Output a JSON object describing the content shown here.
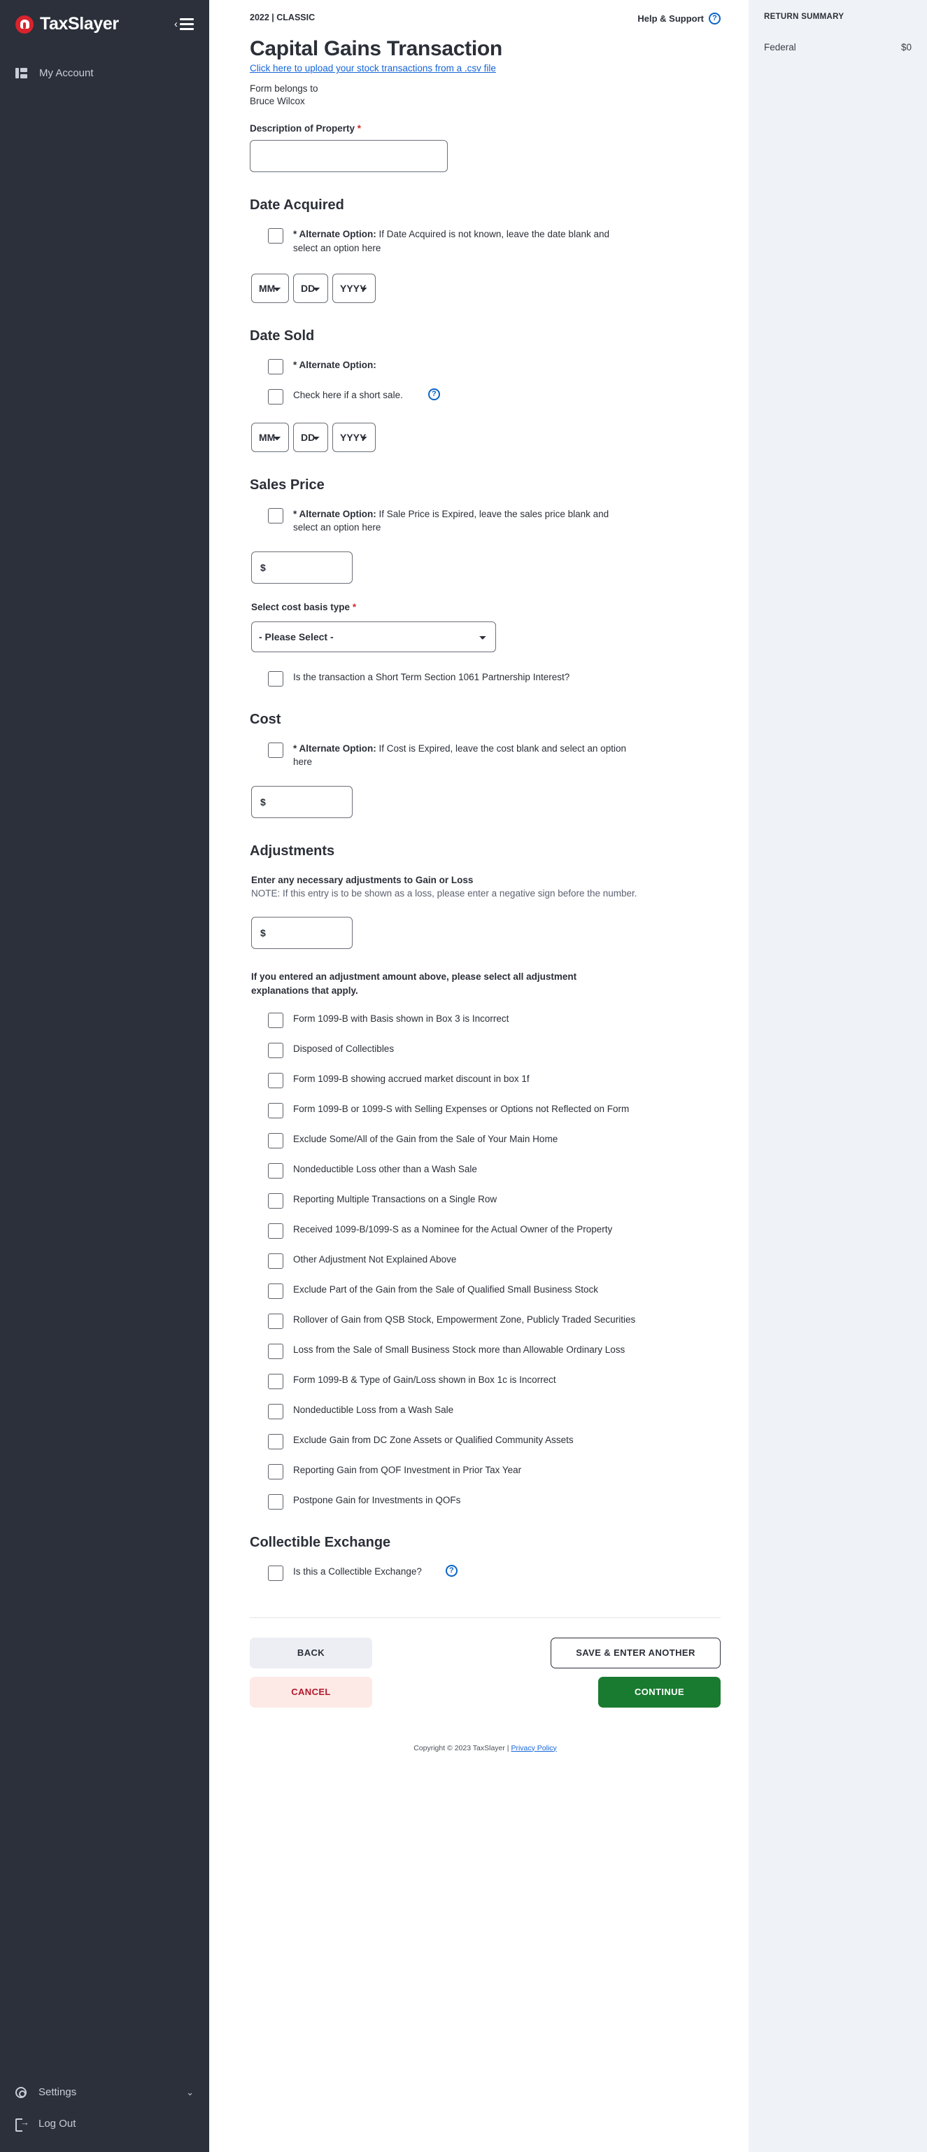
{
  "sidebar": {
    "brand": "TaxSlayer",
    "collapse_label": "‹",
    "items": [
      {
        "label": "My Account"
      }
    ],
    "bottom_items": [
      {
        "label": "Settings",
        "caret": "⌄"
      },
      {
        "label": "Log Out"
      }
    ]
  },
  "topbar": {
    "tax_year_package": "2022 | CLASSIC",
    "help_label": "Help & Support",
    "help_icon_glyph": "?"
  },
  "summary": {
    "title": "RETURN SUMMARY",
    "rows": [
      {
        "label": "Federal",
        "value": "$0"
      }
    ]
  },
  "page": {
    "title": "Capital Gains Transaction",
    "csv_link": "Click here to upload your stock transactions from a .csv file",
    "belongs_label": "Form belongs to",
    "belongs_name": "Bruce Wilcox"
  },
  "description": {
    "label": "Description of Property",
    "required_mark": "*",
    "value": "",
    "placeholder": ""
  },
  "date_acquired": {
    "heading": "Date Acquired",
    "alt_prefix": "* Alternate Option:",
    "alt_text": " If Date Acquired is not known, leave the date blank and select an option here",
    "mm": "MM",
    "dd": "DD",
    "yyyy": "YYYY"
  },
  "date_sold": {
    "heading": "Date Sold",
    "alt_prefix": "* Alternate Option:",
    "alt_text": "",
    "short_sale_label": "Check here if a short sale.",
    "help_glyph": "?",
    "mm": "MM",
    "dd": "DD",
    "yyyy": "YYYY"
  },
  "sales_price": {
    "heading": "Sales Price",
    "alt_prefix": "* Alternate Option:",
    "alt_text": " If Sale Price is Expired, leave the sales price blank and select an option here",
    "amount_placeholder": "$",
    "amount_value": "",
    "cost_basis_label": "Select cost basis type",
    "required_mark": "*",
    "cost_basis_selected": "- Please Select -",
    "cost_basis_options": [
      "- Please Select -"
    ],
    "sec1061_label": "Is the transaction a Short Term Section 1061 Partnership Interest?"
  },
  "cost": {
    "heading": "Cost",
    "alt_prefix": "* Alternate Option:",
    "alt_text": " If Cost is Expired, leave the cost blank and select an option here",
    "amount_placeholder": "$",
    "amount_value": ""
  },
  "adjustments": {
    "heading": "Adjustments",
    "bold_label": "Enter any necessary adjustments to Gain or Loss",
    "note": "NOTE: If this entry is to be shown as a loss, please enter a negative sign before the number.",
    "amount_placeholder": "$",
    "amount_value": "",
    "prompt": "If you entered an adjustment amount above, please select all adjustment explanations that apply.",
    "options": [
      "Form 1099-B with Basis shown in Box 3 is Incorrect",
      "Disposed of Collectibles",
      "Form 1099-B showing accrued market discount in box 1f",
      "Form 1099-B or 1099-S with Selling Expenses or Options not Reflected on Form",
      "Exclude Some/All of the Gain from the Sale of Your Main Home",
      "Nondeductible Loss other than a Wash Sale",
      "Reporting Multiple Transactions on a Single Row",
      "Received 1099-B/1099-S as a Nominee for the Actual Owner of the Property",
      "Other Adjustment Not Explained Above",
      "Exclude Part of the Gain from the Sale of Qualified Small Business Stock",
      "Rollover of Gain from QSB Stock, Empowerment Zone, Publicly Traded Securities",
      "Loss from the Sale of Small Business Stock more than Allowable Ordinary Loss",
      "Form 1099-B & Type of Gain/Loss shown in Box 1c is Incorrect",
      "Nondeductible Loss from a Wash Sale",
      "Exclude Gain from DC Zone Assets or Qualified Community Assets",
      "Reporting Gain from QOF Investment in Prior Tax Year",
      "Postpone Gain for Investments in QOFs"
    ]
  },
  "collectible": {
    "heading": "Collectible Exchange",
    "label": "Is this a Collectible Exchange?",
    "help_glyph": "?"
  },
  "buttons": {
    "back": "BACK",
    "cancel": "CANCEL",
    "save_enter_another": "SAVE & ENTER ANOTHER",
    "continue": "CONTINUE"
  },
  "footer": {
    "copyright": "Copyright © 2023 TaxSlayer | ",
    "privacy": "Privacy Policy"
  },
  "colors": {
    "brand_red": "#d9232d",
    "continue_green": "#197b30",
    "cancel_red": "#b3182c",
    "link_blue": "#1565d8",
    "sidebar_bg": "#2b303b",
    "summary_bg": "#eff3f7"
  }
}
